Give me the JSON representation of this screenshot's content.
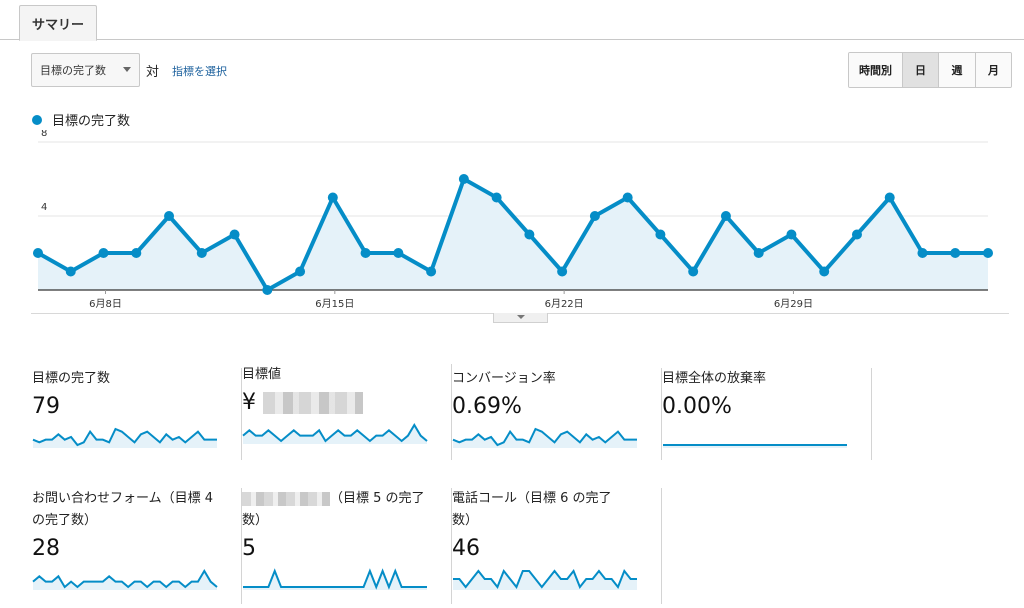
{
  "tabs": [
    {
      "label": "サマリー"
    }
  ],
  "controls": {
    "metric_select": "目標の完了数",
    "vs_label": "対",
    "select_metric_link": "指標を選択",
    "periods": [
      {
        "label": "時間別",
        "active": false
      },
      {
        "label": "日",
        "active": true
      },
      {
        "label": "週",
        "active": false
      },
      {
        "label": "月",
        "active": false
      }
    ]
  },
  "chart_data": {
    "type": "area",
    "series": [
      {
        "name": "目標の完了数",
        "color": "#058dc7",
        "values": [
          2,
          1,
          2,
          2,
          4,
          2,
          3,
          0,
          1,
          5,
          2,
          2,
          1,
          6,
          5,
          3,
          1,
          4,
          5,
          3,
          1,
          4,
          2,
          3,
          1,
          3,
          5,
          2,
          2,
          2
        ]
      }
    ],
    "x_tick_labels": [
      {
        "index": 2,
        "label": "6月8日"
      },
      {
        "index": 9,
        "label": "6月15日"
      },
      {
        "index": 16,
        "label": "6月22日"
      },
      {
        "index": 23,
        "label": "6月29日"
      }
    ],
    "y_ticks": [
      4,
      8
    ],
    "ylim": [
      0,
      8
    ],
    "grid": true,
    "legend": "top-left"
  },
  "scorecards": [
    {
      "title": "目標の完了数",
      "value": "79",
      "spark": [
        2,
        1,
        2,
        2,
        4,
        2,
        3,
        0,
        1,
        5,
        2,
        2,
        1,
        6,
        5,
        3,
        1,
        4,
        5,
        3,
        1,
        4,
        2,
        3,
        1,
        3,
        5,
        2,
        2,
        2
      ]
    },
    {
      "title": "目標値",
      "value": "¥",
      "redacted": true,
      "spark": [
        1,
        2,
        1,
        1,
        2,
        1,
        0,
        1,
        2,
        1,
        1,
        1,
        2,
        0,
        1,
        2,
        1,
        1,
        2,
        1,
        0,
        1,
        1,
        2,
        1,
        0,
        1,
        3,
        1,
        0
      ]
    },
    {
      "title": "コンバージョン率",
      "value": "0.69%",
      "spark": [
        2,
        1,
        2,
        2,
        4,
        2,
        3,
        0,
        1,
        5,
        2,
        2,
        1,
        6,
        5,
        3,
        1,
        4,
        5,
        3,
        1,
        4,
        2,
        3,
        1,
        3,
        5,
        2,
        2,
        2
      ]
    },
    {
      "title": "目標全体の放棄率",
      "value": "0.00%",
      "spark": [
        0,
        0,
        0,
        0,
        0,
        0,
        0,
        0,
        0,
        0,
        0,
        0,
        0,
        0,
        0,
        0,
        0,
        0,
        0,
        0,
        0,
        0,
        0,
        0,
        0,
        0,
        0,
        0,
        0,
        0
      ]
    },
    {
      "title": "お問い合わせフォーム（目標 4\nの完了数）",
      "value": "28",
      "spark": [
        1,
        2,
        1,
        1,
        2,
        0,
        1,
        0,
        1,
        1,
        1,
        1,
        2,
        1,
        1,
        0,
        1,
        1,
        0,
        1,
        1,
        0,
        1,
        1,
        0,
        1,
        1,
        3,
        1,
        0
      ]
    },
    {
      "title": "（目標 5 の完了\n数）",
      "redacted_prefix": true,
      "value": "5",
      "spark": [
        0,
        0,
        0,
        0,
        0,
        1,
        0,
        0,
        0,
        0,
        0,
        0,
        0,
        0,
        0,
        0,
        0,
        0,
        0,
        0,
        1,
        0,
        1,
        0,
        1,
        0,
        0,
        0,
        0,
        0
      ]
    },
    {
      "title": "電話コール（目標 6 の完了\n数）",
      "value": "46",
      "spark": [
        1,
        1,
        0,
        1,
        2,
        1,
        1,
        0,
        2,
        1,
        0,
        2,
        2,
        1,
        0,
        1,
        2,
        1,
        1,
        2,
        0,
        1,
        1,
        2,
        1,
        1,
        0,
        2,
        1,
        1
      ]
    }
  ]
}
